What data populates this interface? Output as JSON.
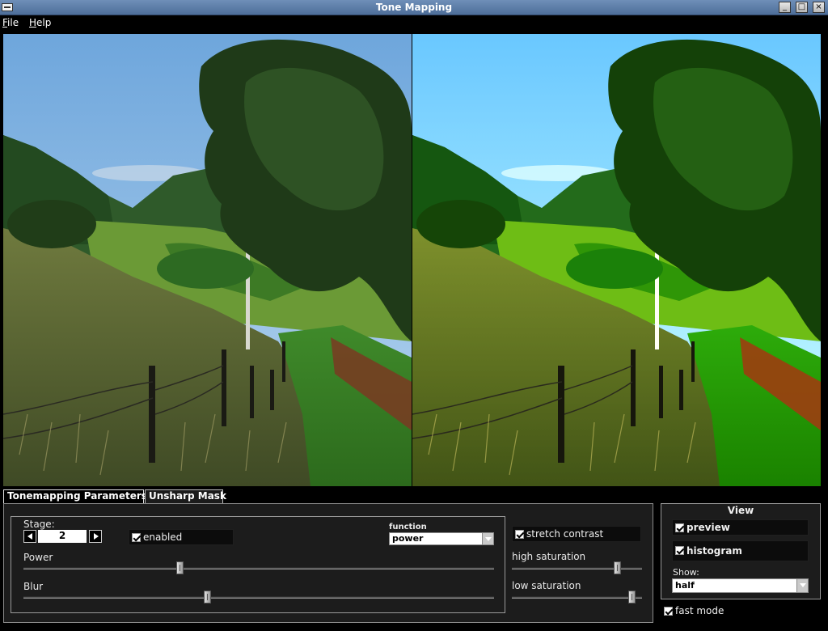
{
  "window": {
    "title": "Tone Mapping",
    "buttons": [
      "_",
      "□",
      "×"
    ]
  },
  "menu": {
    "items": [
      "File",
      "Help"
    ]
  },
  "tabs": [
    {
      "label": "Tonemapping Parameters",
      "active": true
    },
    {
      "label": "Unsharp Mask",
      "active": false
    }
  ],
  "stage": {
    "label": "Stage:",
    "value": "2",
    "enabled_label": "enabled",
    "enabled": true,
    "function_label": "function",
    "function_value": "power",
    "power_label": "Power",
    "power_level": 0.33,
    "blur_label": "Blur",
    "blur_level": 0.39
  },
  "contrast": {
    "stretch_label": "stretch contrast",
    "stretch": true,
    "high_label": "high saturation",
    "high_level": 0.83,
    "low_label": "low saturation",
    "low_level": 0.95
  },
  "view": {
    "title": "View",
    "preview_label": "preview",
    "preview": true,
    "histogram_label": "histogram",
    "histogram": true,
    "show_label": "Show:",
    "show_value": "half",
    "fast_label": "fast mode",
    "fast": true
  },
  "colors": {
    "sky": "#7ab0e0",
    "titlebar": "#5d7ea8",
    "panel": "#1c1c1c"
  }
}
